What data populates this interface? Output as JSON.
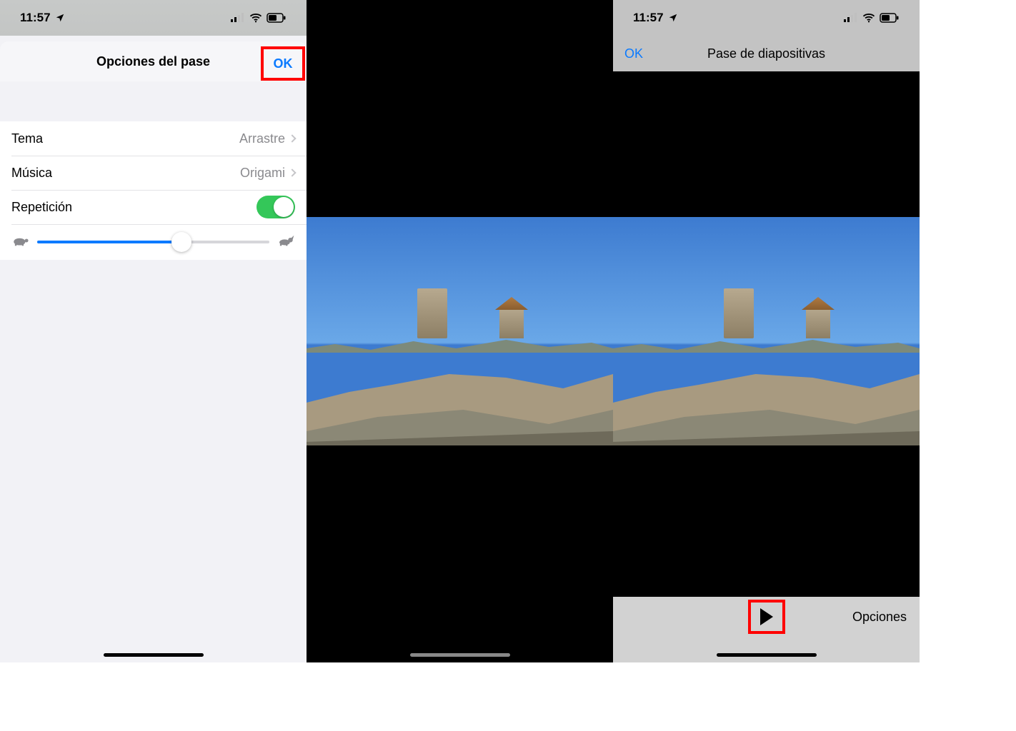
{
  "status": {
    "time": "11:57",
    "signal_bars": 2,
    "wifi_active": true,
    "battery_percent_approx": 55
  },
  "pane1": {
    "title": "Opciones del pase",
    "ok_label": "OK",
    "rows": {
      "theme": {
        "label": "Tema",
        "value": "Arrastre"
      },
      "music": {
        "label": "Música",
        "value": "Origami"
      },
      "repeat": {
        "label": "Repetición",
        "on": true
      }
    },
    "speed_slider": {
      "value_fraction": 0.62,
      "slow_icon": "turtle-icon",
      "fast_icon": "rabbit-icon"
    }
  },
  "pane3": {
    "ok_label": "OK",
    "title": "Pase de diapositivas",
    "options_label": "Opciones"
  }
}
